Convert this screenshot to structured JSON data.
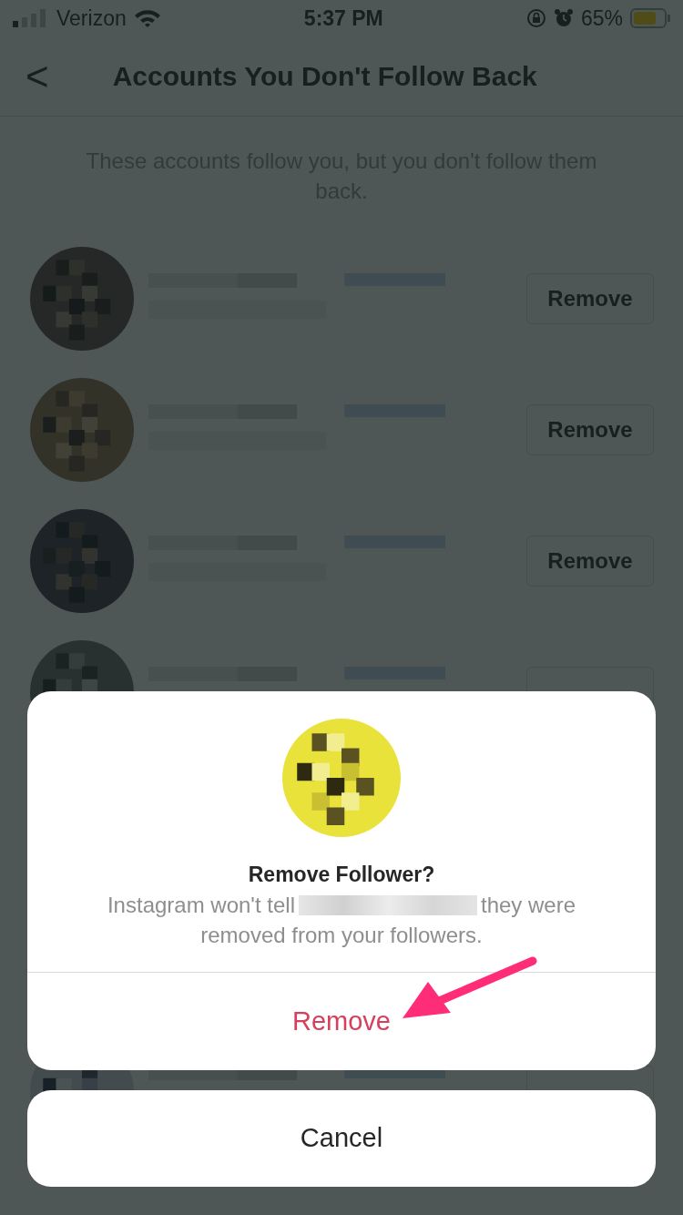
{
  "status_bar": {
    "carrier": "Verizon",
    "time": "5:37 PM",
    "battery": "65%"
  },
  "header": {
    "back": "<",
    "title": "Accounts You Don't Follow Back"
  },
  "subtitle": "These accounts follow you, but you don't follow them back.",
  "rows": [
    {
      "button": "Remove"
    },
    {
      "button": "Remove"
    },
    {
      "button": "Remove"
    },
    {},
    {
      "kind": "profile"
    }
  ],
  "dialog": {
    "title": "Remove Follower?",
    "message_start": "Instagram won't tell",
    "message_end": "they were",
    "message_line2": "removed from your followers.",
    "action": "Remove"
  },
  "cancel": "Cancel"
}
